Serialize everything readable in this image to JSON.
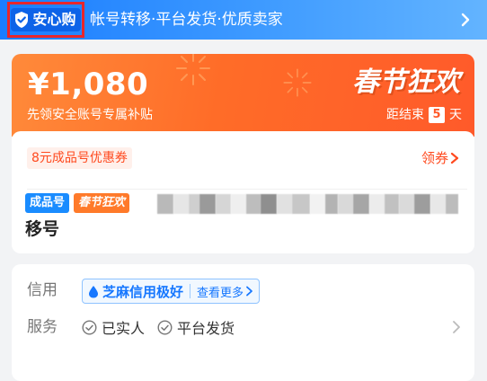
{
  "banner": {
    "logo_text": "安心购",
    "tagline": "帐号转移·平台发货·优质卖家"
  },
  "promo": {
    "price": "¥1,080",
    "subtitle": "先领安全账号专属补贴",
    "festival_text": "春节狂欢",
    "countdown_prefix": "距结束",
    "countdown_days": "5",
    "countdown_suffix": "天"
  },
  "coupon": {
    "tag": "8元成品号优惠券",
    "claim_label": "领券"
  },
  "listing": {
    "type_tag": "成品号",
    "festival_tag": "春节狂欢",
    "title_tail": "移号"
  },
  "info": {
    "credit_label": "信用",
    "credit_value": "芝麻信用极好",
    "credit_more": "查看更多",
    "service_label": "服务",
    "services": [
      "已实人",
      "平台发货"
    ]
  },
  "colors": {
    "brand_blue": "#1a7dff",
    "promo_orange": "#ff6c28",
    "accent_red": "#ff4a1f"
  }
}
